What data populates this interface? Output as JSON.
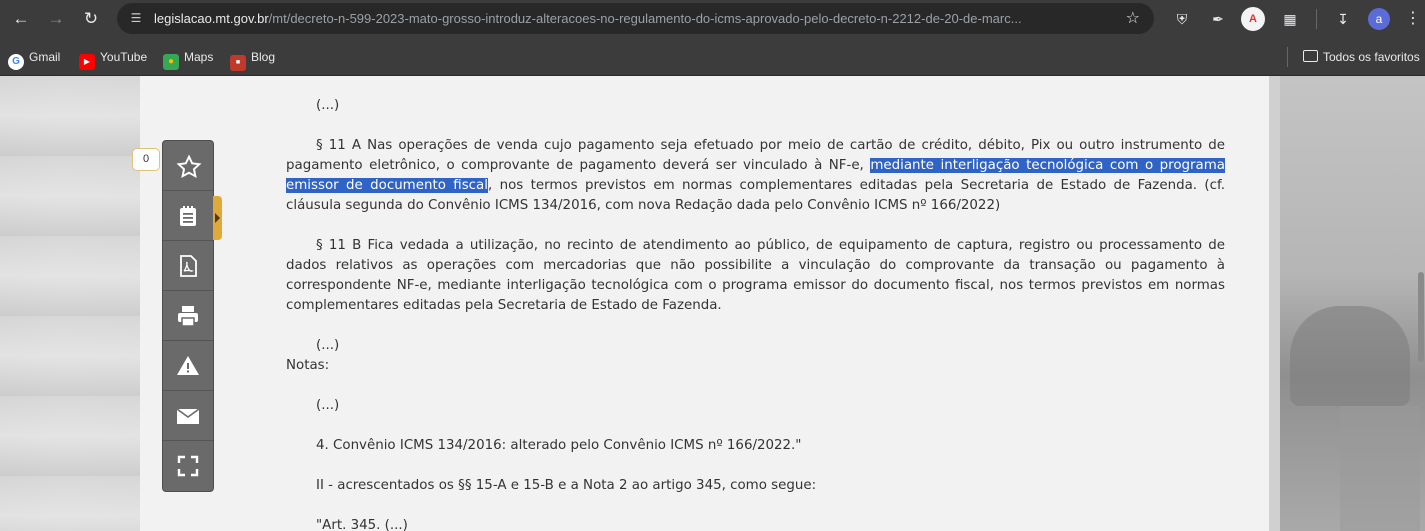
{
  "browser": {
    "url_host": "legislacao.mt.gov.br",
    "url_path": "/mt/decreto-n-599-2023-mato-grosso-introduz-alteracoes-no-regulamento-do-icms-aprovado-pelo-decreto-n-2212-de-20-de-marc...",
    "avatar_letter": "a",
    "nav": {
      "back_icon": "back-arrow-icon",
      "forward_icon": "forward-arrow-icon",
      "reload_icon": "reload-icon"
    }
  },
  "bookmarks": {
    "items": [
      {
        "label": "Gmail",
        "icon": "gmail-icon"
      },
      {
        "label": "YouTube",
        "icon": "youtube-icon"
      },
      {
        "label": "Maps",
        "icon": "maps-icon"
      },
      {
        "label": "Blog",
        "icon": "blog-icon"
      }
    ],
    "all_favorites": "Todos os favoritos"
  },
  "side_tools": {
    "favorite_count": "0",
    "tools": [
      "star-icon",
      "notepad-icon",
      "pdf-icon",
      "print-icon",
      "warning-icon",
      "email-icon",
      "fullscreen-icon"
    ]
  },
  "document": {
    "p1": "(...)",
    "p2_before": "§ 11 A Nas operações de venda cujo pagamento seja efetuado por meio de cartão de crédito, débito, Pix ou outro instrumento de pagamento eletrônico, o comprovante de pagamento deverá ser vinculado à NF-e, ",
    "p2_highlight": "mediante interligação tecnológica com o programa emissor de documento fiscal",
    "p2_after": ", nos termos previstos em normas complementares editadas pela Secretaria de Estado de Fazenda. (cf. cláusula segunda do Convênio ICMS 134/2016, com nova Redação dada pelo Convênio ICMS nº 166/2022)",
    "p3": "§ 11 B Fica vedada a utilização, no recinto de atendimento ao público, de equipamento de captura, registro ou processamento de dados relativos as operações com mercadorias que não possibilite a vinculação do comprovante da transação ou pagamento à correspondente NF-e, mediante interligação tecnológica com o programa emissor do documento fiscal, nos termos previstos em normas complementares editadas pela Secretaria de Estado de Fazenda.",
    "p4": "(...)",
    "p5": "Notas:",
    "p6": "(...)",
    "p7": "4. Convênio ICMS 134/2016: alterado pelo Convênio ICMS nº 166/2022.\"",
    "p8": "II - acrescentados os §§ 15-A e 15-B e a Nota 2 ao artigo 345, como segue:",
    "p9": "\"Art. 345. (...)"
  }
}
